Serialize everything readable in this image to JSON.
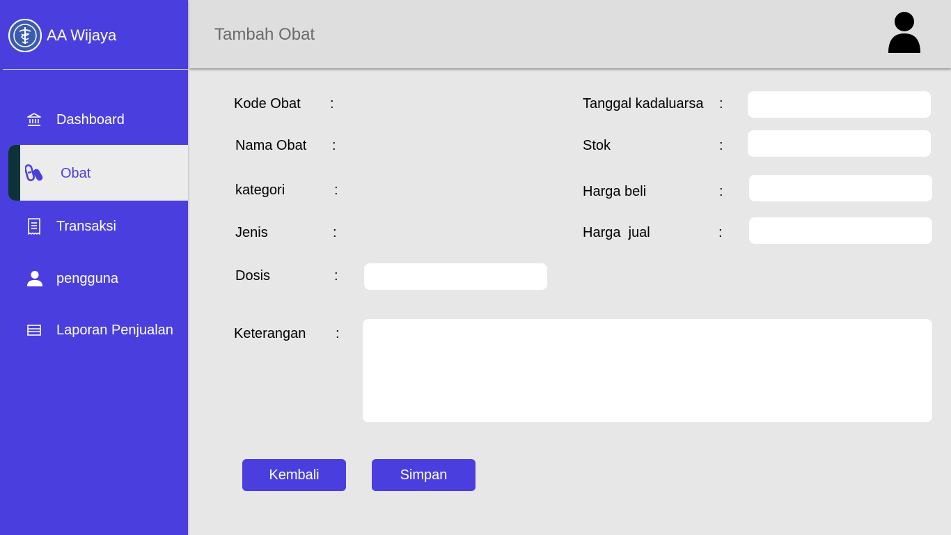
{
  "app": {
    "brand_name": "AA Wijaya"
  },
  "header": {
    "title": "Tambah Obat"
  },
  "sidebar": {
    "items": [
      {
        "label": "Dashboard",
        "icon": "bank-icon"
      },
      {
        "label": "Obat",
        "icon": "pills-icon",
        "active": true
      },
      {
        "label": "Transaksi",
        "icon": "receipt-icon"
      },
      {
        "label": "pengguna",
        "icon": "user-icon"
      },
      {
        "label": "Laporan Penjualan",
        "icon": "report-icon"
      }
    ]
  },
  "form": {
    "colon": ":",
    "kode_obat": {
      "label": "Kode Obat"
    },
    "nama_obat": {
      "label": "Nama Obat"
    },
    "kategori": {
      "label": "kategori"
    },
    "jenis": {
      "label": "Jenis"
    },
    "dosis": {
      "label": "Dosis",
      "value": "",
      "placeholder": ""
    },
    "keterangan": {
      "label": "Keterangan",
      "value": "",
      "placeholder": ""
    },
    "tanggal_kadaluarsa": {
      "label": "Tanggal kadaluarsa",
      "value": "",
      "placeholder": ""
    },
    "stok": {
      "label": "Stok",
      "value": "",
      "placeholder": ""
    },
    "harga_beli": {
      "label": "Harga beli",
      "value": "",
      "placeholder": ""
    },
    "harga_jual": {
      "label": "Harga  jual",
      "value": "",
      "placeholder": ""
    }
  },
  "buttons": {
    "back_label": "Kembali",
    "save_label": "Simpan"
  },
  "colors": {
    "primary": "#4a3fde",
    "active_accent": "#0d3238",
    "header_bg": "#dedede",
    "content_bg": "#e7e7e7"
  }
}
